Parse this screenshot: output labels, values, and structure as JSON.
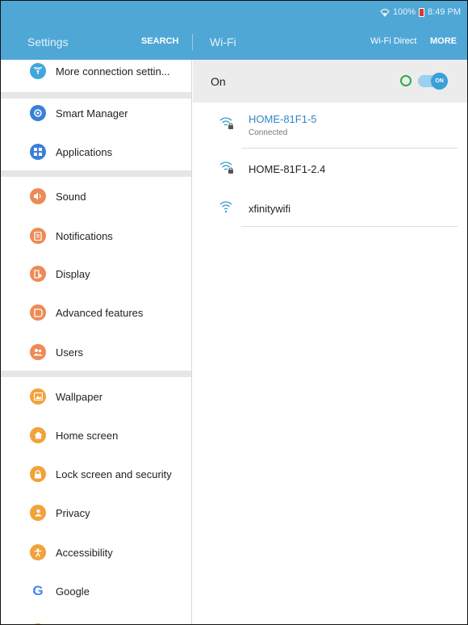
{
  "status_bar": {
    "battery": "100%",
    "time": "8:49 PM"
  },
  "action_bar": {
    "left_title": "Settings",
    "search": "SEARCH",
    "right_title": "Wi-Fi",
    "wifi_direct": "Wi-Fi Direct",
    "more": "MORE"
  },
  "sidebar": {
    "items": [
      {
        "label": "More connection settin...",
        "icon": "signal-icon",
        "color": "#3fa7dc"
      },
      {
        "label": "Smart Manager",
        "icon": "smart-manager-icon",
        "color": "#3a7fd8"
      },
      {
        "label": "Applications",
        "icon": "apps-grid-icon",
        "color": "#3a7fd8"
      },
      {
        "label": "Sound",
        "icon": "speaker-icon",
        "color": "#ee8a55"
      },
      {
        "label": "Notifications",
        "icon": "notification-icon",
        "color": "#ee8a55"
      },
      {
        "label": "Display",
        "icon": "display-icon",
        "color": "#ee8a55"
      },
      {
        "label": "Advanced features",
        "icon": "advanced-features-icon",
        "color": "#ee8a55"
      },
      {
        "label": "Users",
        "icon": "users-icon",
        "color": "#ee8a55"
      },
      {
        "label": "Wallpaper",
        "icon": "wallpaper-icon",
        "color": "#f2a23a"
      },
      {
        "label": "Home screen",
        "icon": "home-icon",
        "color": "#f2a23a"
      },
      {
        "label": "Lock screen and security",
        "icon": "lock-icon",
        "color": "#f2a23a"
      },
      {
        "label": "Privacy",
        "icon": "privacy-icon",
        "color": "#f2a23a"
      },
      {
        "label": "Accessibility",
        "icon": "accessibility-icon",
        "color": "#f2a23a"
      },
      {
        "label": "Google",
        "icon": "google-icon",
        "color": "#4285f4"
      }
    ]
  },
  "wifi": {
    "on_label": "On",
    "toggle_text": "ON",
    "networks": [
      {
        "name": "HOME-81F1-5",
        "status": "Connected",
        "secured": true
      },
      {
        "name": "HOME-81F1-2.4",
        "status": "",
        "secured": true
      },
      {
        "name": "xfinitywifi",
        "status": "",
        "secured": false
      }
    ]
  }
}
